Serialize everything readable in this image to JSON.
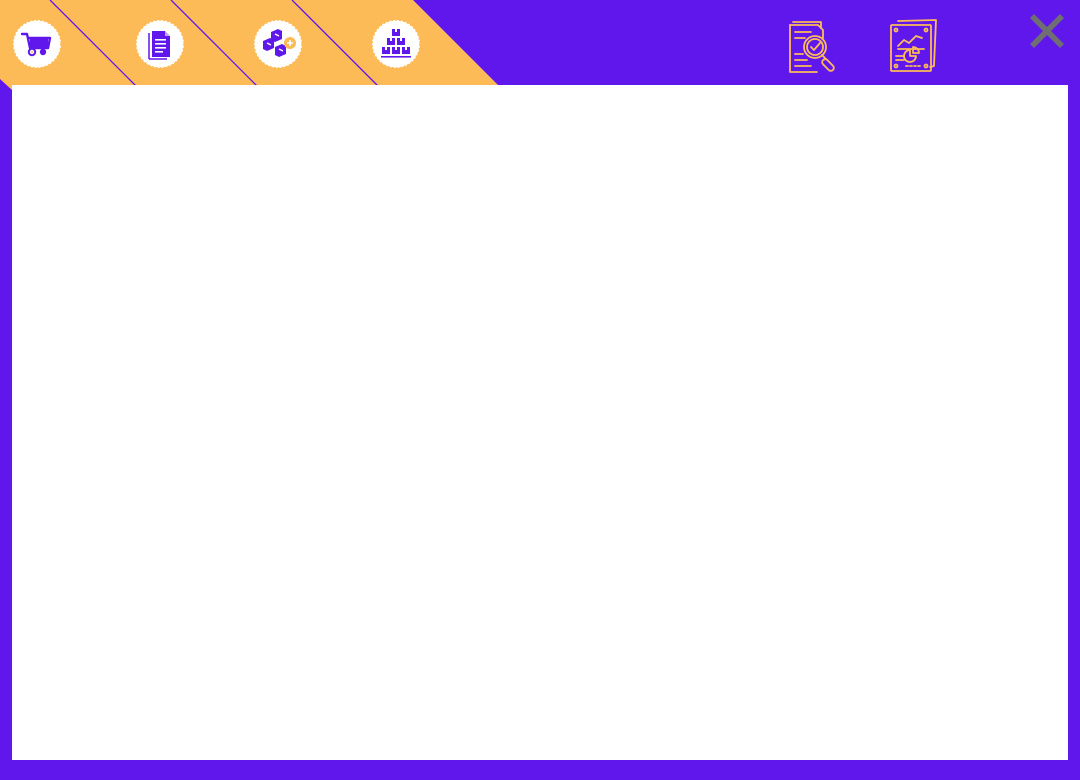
{
  "theme": {
    "frame_color": "#5f17ec",
    "tab_strip_color": "#fdbb58",
    "content_background": "#ffffff",
    "close_icon_color": "#6e6e73"
  },
  "nav_buttons": [
    {
      "icon": "shopping-cart-icon"
    },
    {
      "icon": "document-icon"
    },
    {
      "icon": "boxes-add-icon"
    },
    {
      "icon": "stacked-boxes-icon"
    }
  ],
  "tools": [
    {
      "icon": "document-search-check-icon"
    },
    {
      "icon": "report-chart-icon"
    }
  ],
  "close": {
    "icon": "close-icon"
  }
}
